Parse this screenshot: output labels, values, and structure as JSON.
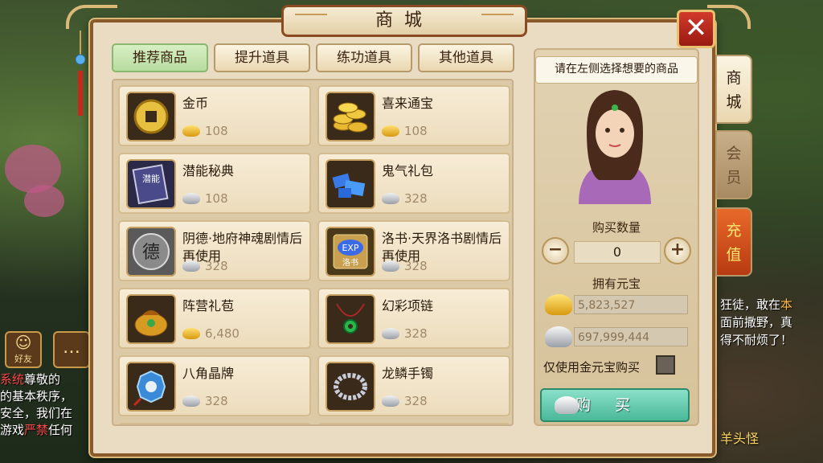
{
  "window": {
    "title": "商城",
    "close_label": "✕"
  },
  "tabs": [
    {
      "label": "推荐商品",
      "active": true
    },
    {
      "label": "提升道具",
      "active": false
    },
    {
      "label": "练功道具",
      "active": false
    },
    {
      "label": "其他道具",
      "active": false
    }
  ],
  "items": [
    {
      "name": "金币",
      "currency": "gold",
      "price": "108",
      "icon": "copper-coin-icon"
    },
    {
      "name": "喜来通宝",
      "currency": "gold",
      "price": "108",
      "icon": "coin-stack-icon"
    },
    {
      "name": "潜能秘典",
      "currency": "silver",
      "price": "108",
      "icon": "book-icon",
      "icon_text": "潜能"
    },
    {
      "name": "鬼气礼包",
      "currency": "silver",
      "price": "328",
      "icon": "blue-crystal-icon"
    },
    {
      "name": "阴德·地府神魂剧情后再使用",
      "currency": "silver",
      "price": "328",
      "icon": "de-token-icon",
      "icon_text": "德"
    },
    {
      "name": "洛书·天界洛书剧情后再使用",
      "currency": "silver",
      "price": "328",
      "icon": "exp-scroll-icon",
      "icon_text": "EXP",
      "icon_text2": "洛书"
    },
    {
      "name": "阵营礼苞",
      "currency": "gold",
      "price": "6,480",
      "icon": "gift-bag-icon"
    },
    {
      "name": "幻彩项链",
      "currency": "silver",
      "price": "328",
      "icon": "jade-necklace-icon"
    },
    {
      "name": "八角晶牌",
      "currency": "silver",
      "price": "328",
      "icon": "crystal-plaque-icon"
    },
    {
      "name": "龙鳞手镯",
      "currency": "silver",
      "price": "328",
      "icon": "bracelet-icon"
    }
  ],
  "panel": {
    "hint": "请在左侧选择想要的商品",
    "quantity_label": "购买数量",
    "quantity": "0",
    "minus": "−",
    "plus": "+",
    "owned_label": "拥有元宝",
    "gold_amount": "5,823,527",
    "silver_amount": "697,999,444",
    "only_gold_label": "仅使用金元宝购买",
    "buy_label": "购买"
  },
  "side_tabs": [
    {
      "label": "商城"
    },
    {
      "label": "会员"
    },
    {
      "label": "充值"
    }
  ],
  "background": {
    "chat_tag": "系统",
    "chat_lines": [
      "尊敬的",
      "的基本秩序，",
      "安全，我们在",
      "游戏"
    ],
    "chat_banned": "严禁",
    "chat_tail": "任何",
    "friend_label": "好友",
    "right_log": [
      "狂徒，敢在",
      "面前撒野，真",
      "得不耐烦了！"
    ],
    "right_log_highlight": "本",
    "monster_name": "羊头怪"
  },
  "colors": {
    "accent_green": "#b8dca0",
    "close_red": "#c8281c",
    "charge_orange": "#d85a1a",
    "buy_teal": "#6ad0b4"
  }
}
